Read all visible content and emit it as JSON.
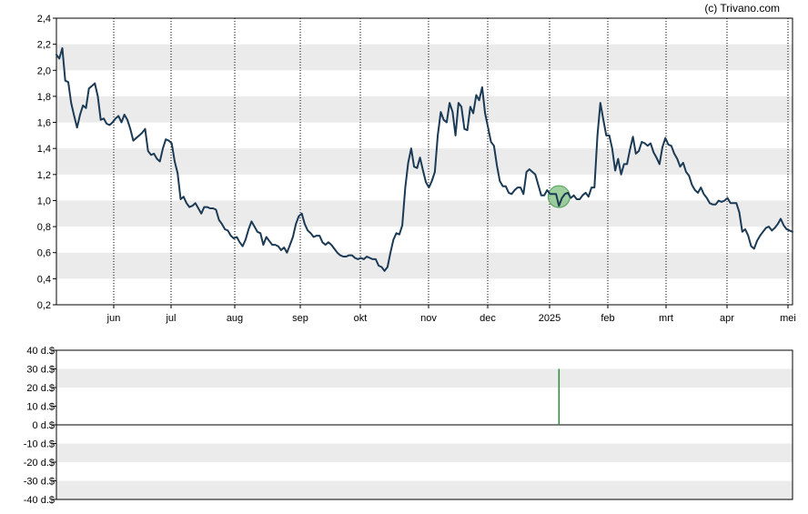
{
  "credit": "(c) Trivano.com",
  "colors": {
    "price_line": "#1b3a55",
    "band": "#ebebeb",
    "grid": "#000000",
    "frame": "#000000",
    "marker_fill": "#7fbf7f",
    "marker_stroke": "#4f9f5a",
    "volume_bar": "#2a8a3a"
  },
  "chart_data": [
    {
      "type": "line",
      "y_ticks": [
        "2,4",
        "2,2",
        "2,0",
        "1,8",
        "1,6",
        "1,4",
        "1,2",
        "1,0",
        "0,8",
        "0,6",
        "0,4",
        "0,2"
      ],
      "x_ticks": [
        "jun",
        "jul",
        "aug",
        "sep",
        "okt",
        "nov",
        "dec",
        "2025",
        "feb",
        "mrt",
        "apr",
        "mei"
      ],
      "ylim": [
        0.2,
        2.4
      ],
      "grid": "vertical dotted at month ticks, alternating horizontal bands",
      "series": [
        {
          "points": [
            [
              0,
              2.12
            ],
            [
              1,
              2.09
            ],
            [
              2,
              2.17
            ],
            [
              3,
              1.92
            ],
            [
              4,
              1.91
            ],
            [
              5,
              1.75
            ],
            [
              6,
              1.65
            ],
            [
              7,
              1.56
            ],
            [
              8,
              1.66
            ],
            [
              9,
              1.73
            ],
            [
              10,
              1.71
            ],
            [
              11,
              1.86
            ],
            [
              12,
              1.88
            ],
            [
              13,
              1.9
            ],
            [
              14,
              1.8
            ],
            [
              15,
              1.62
            ],
            [
              16,
              1.63
            ],
            [
              17,
              1.59
            ],
            [
              18,
              1.58
            ],
            [
              19,
              1.6
            ],
            [
              20,
              1.63
            ],
            [
              21,
              1.65
            ],
            [
              22,
              1.6
            ],
            [
              23,
              1.66
            ],
            [
              24,
              1.62
            ],
            [
              25,
              1.55
            ],
            [
              26,
              1.46
            ],
            [
              27,
              1.48
            ],
            [
              28,
              1.5
            ],
            [
              29,
              1.52
            ],
            [
              30,
              1.55
            ],
            [
              31,
              1.38
            ],
            [
              32,
              1.35
            ],
            [
              33,
              1.36
            ],
            [
              34,
              1.32
            ],
            [
              35,
              1.3
            ],
            [
              36,
              1.4
            ],
            [
              37,
              1.47
            ],
            [
              38,
              1.46
            ],
            [
              39,
              1.44
            ],
            [
              40,
              1.3
            ],
            [
              41,
              1.21
            ],
            [
              42,
              1.01
            ],
            [
              43,
              1.03
            ],
            [
              44,
              0.98
            ],
            [
              45,
              0.95
            ],
            [
              46,
              0.96
            ],
            [
              47,
              0.98
            ],
            [
              48,
              0.94
            ],
            [
              49,
              0.9
            ],
            [
              50,
              0.95
            ],
            [
              51,
              0.95
            ],
            [
              52,
              0.94
            ],
            [
              53,
              0.94
            ],
            [
              54,
              0.93
            ],
            [
              55,
              0.85
            ],
            [
              56,
              0.82
            ],
            [
              57,
              0.78
            ],
            [
              58,
              0.77
            ],
            [
              59,
              0.73
            ],
            [
              60,
              0.71
            ],
            [
              61,
              0.72
            ],
            [
              62,
              0.68
            ],
            [
              63,
              0.65
            ],
            [
              64,
              0.7
            ],
            [
              65,
              0.78
            ],
            [
              66,
              0.84
            ],
            [
              67,
              0.8
            ],
            [
              68,
              0.76
            ],
            [
              69,
              0.75
            ],
            [
              70,
              0.66
            ],
            [
              71,
              0.72
            ],
            [
              72,
              0.69
            ],
            [
              73,
              0.66
            ],
            [
              74,
              0.66
            ],
            [
              75,
              0.65
            ],
            [
              76,
              0.62
            ],
            [
              77,
              0.64
            ],
            [
              78,
              0.6
            ],
            [
              79,
              0.66
            ],
            [
              80,
              0.72
            ],
            [
              81,
              0.82
            ],
            [
              82,
              0.88
            ],
            [
              83,
              0.9
            ],
            [
              84,
              0.82
            ],
            [
              85,
              0.77
            ],
            [
              86,
              0.75
            ],
            [
              87,
              0.72
            ],
            [
              88,
              0.73
            ],
            [
              89,
              0.73
            ],
            [
              90,
              0.68
            ],
            [
              91,
              0.66
            ],
            [
              92,
              0.68
            ],
            [
              93,
              0.66
            ],
            [
              94,
              0.63
            ],
            [
              95,
              0.6
            ],
            [
              96,
              0.58
            ],
            [
              97,
              0.57
            ],
            [
              98,
              0.57
            ],
            [
              99,
              0.58
            ],
            [
              100,
              0.58
            ],
            [
              101,
              0.56
            ],
            [
              102,
              0.55
            ],
            [
              103,
              0.56
            ],
            [
              104,
              0.55
            ],
            [
              105,
              0.57
            ],
            [
              106,
              0.56
            ],
            [
              107,
              0.55
            ],
            [
              108,
              0.55
            ],
            [
              109,
              0.5
            ],
            [
              110,
              0.49
            ],
            [
              111,
              0.46
            ],
            [
              112,
              0.49
            ],
            [
              113,
              0.6
            ],
            [
              114,
              0.7
            ],
            [
              115,
              0.75
            ],
            [
              116,
              0.74
            ],
            [
              117,
              0.81
            ],
            [
              118,
              1.1
            ],
            [
              119,
              1.29
            ],
            [
              120,
              1.4
            ],
            [
              121,
              1.26
            ],
            [
              122,
              1.25
            ],
            [
              123,
              1.33
            ],
            [
              124,
              1.23
            ],
            [
              125,
              1.14
            ],
            [
              126,
              1.1
            ],
            [
              127,
              1.15
            ],
            [
              128,
              1.22
            ],
            [
              129,
              1.5
            ],
            [
              130,
              1.68
            ],
            [
              131,
              1.62
            ],
            [
              132,
              1.6
            ],
            [
              133,
              1.75
            ],
            [
              134,
              1.68
            ],
            [
              135,
              1.5
            ],
            [
              136,
              1.75
            ],
            [
              137,
              1.72
            ],
            [
              138,
              1.55
            ],
            [
              139,
              1.54
            ],
            [
              140,
              1.72
            ],
            [
              141,
              1.67
            ],
            [
              142,
              1.81
            ],
            [
              143,
              1.77
            ],
            [
              144,
              1.87
            ],
            [
              145,
              1.67
            ],
            [
              146,
              1.56
            ],
            [
              147,
              1.45
            ],
            [
              148,
              1.42
            ],
            [
              149,
              1.27
            ],
            [
              150,
              1.15
            ],
            [
              151,
              1.11
            ],
            [
              152,
              1.11
            ],
            [
              153,
              1.06
            ],
            [
              154,
              1.05
            ],
            [
              155,
              1.08
            ],
            [
              156,
              1.1
            ],
            [
              157,
              1.1
            ],
            [
              158,
              1.05
            ],
            [
              159,
              1.22
            ],
            [
              160,
              1.24
            ],
            [
              161,
              1.22
            ],
            [
              162,
              1.2
            ],
            [
              163,
              1.12
            ],
            [
              164,
              1.04
            ],
            [
              165,
              1.04
            ],
            [
              166,
              1.08
            ],
            [
              167,
              1.05
            ],
            [
              168,
              1.05
            ],
            [
              169,
              1.05
            ],
            [
              170,
              0.96
            ],
            [
              171,
              1.02
            ],
            [
              172,
              1.05
            ],
            [
              173,
              1.06
            ],
            [
              174,
              1.02
            ],
            [
              175,
              1.04
            ],
            [
              176,
              1.01
            ],
            [
              177,
              1.01
            ],
            [
              178,
              1.04
            ],
            [
              179,
              1.06
            ],
            [
              180,
              1.03
            ],
            [
              181,
              1.1
            ],
            [
              182,
              1.1
            ],
            [
              183,
              1.5
            ],
            [
              184,
              1.75
            ],
            [
              185,
              1.62
            ],
            [
              186,
              1.5
            ],
            [
              187,
              1.5
            ],
            [
              188,
              1.4
            ],
            [
              189,
              1.23
            ],
            [
              190,
              1.32
            ],
            [
              191,
              1.2
            ],
            [
              192,
              1.28
            ],
            [
              193,
              1.28
            ],
            [
              194,
              1.39
            ],
            [
              195,
              1.49
            ],
            [
              196,
              1.36
            ],
            [
              197,
              1.38
            ],
            [
              198,
              1.45
            ],
            [
              199,
              1.44
            ],
            [
              200,
              1.42
            ],
            [
              201,
              1.44
            ],
            [
              202,
              1.37
            ],
            [
              203,
              1.33
            ],
            [
              204,
              1.28
            ],
            [
              205,
              1.41
            ],
            [
              206,
              1.48
            ],
            [
              207,
              1.43
            ],
            [
              208,
              1.42
            ],
            [
              209,
              1.36
            ],
            [
              210,
              1.32
            ],
            [
              211,
              1.26
            ],
            [
              212,
              1.29
            ],
            [
              213,
              1.22
            ],
            [
              214,
              1.19
            ],
            [
              215,
              1.12
            ],
            [
              216,
              1.08
            ],
            [
              217,
              1.06
            ],
            [
              218,
              1.1
            ],
            [
              219,
              1.05
            ],
            [
              220,
              1.02
            ],
            [
              221,
              0.98
            ],
            [
              222,
              0.97
            ],
            [
              223,
              0.97
            ],
            [
              224,
              1.0
            ],
            [
              225,
              0.99
            ],
            [
              226,
              1.0
            ],
            [
              227,
              1.02
            ],
            [
              228,
              0.98
            ],
            [
              229,
              0.98
            ],
            [
              230,
              0.98
            ],
            [
              231,
              0.91
            ],
            [
              232,
              0.76
            ],
            [
              233,
              0.78
            ],
            [
              234,
              0.73
            ],
            [
              235,
              0.65
            ],
            [
              236,
              0.63
            ],
            [
              237,
              0.69
            ],
            [
              238,
              0.73
            ],
            [
              239,
              0.76
            ],
            [
              240,
              0.79
            ],
            [
              241,
              0.8
            ],
            [
              242,
              0.77
            ],
            [
              243,
              0.79
            ],
            [
              244,
              0.82
            ],
            [
              245,
              0.86
            ],
            [
              246,
              0.81
            ],
            [
              247,
              0.78
            ],
            [
              248,
              0.77
            ],
            [
              249,
              0.76
            ]
          ]
        }
      ],
      "marker": {
        "x": 170,
        "y": 1.03
      }
    },
    {
      "type": "bar",
      "y_ticks": [
        "40 d.$",
        "30 d.$",
        "20 d.$",
        "10 d.$",
        "0 d.$",
        "-10 d.$",
        "-20 d.$",
        "-30 d.$",
        "-40 d.$"
      ],
      "ylim": [
        -40,
        40
      ],
      "grid": "alternating horizontal bands, zero line",
      "bars": [
        {
          "x": 170,
          "value": 30
        }
      ]
    }
  ]
}
